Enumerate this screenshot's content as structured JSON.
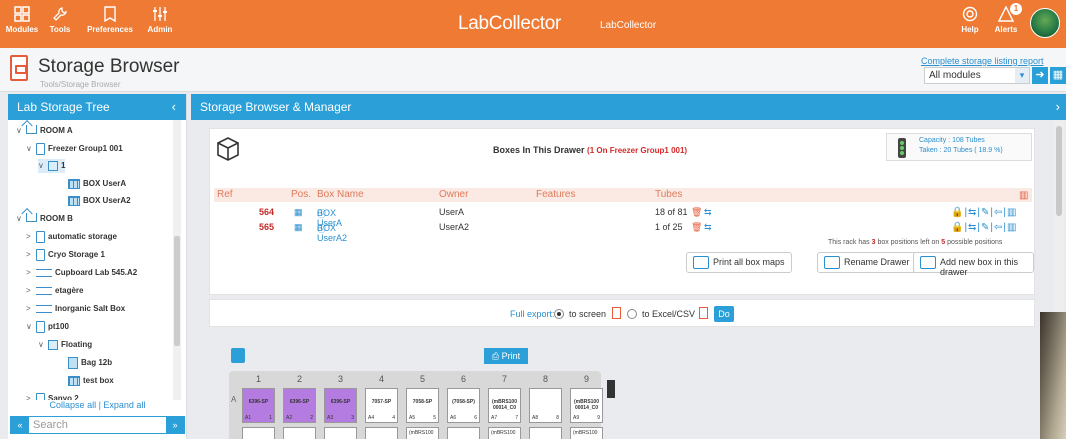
{
  "topbar": {
    "items": [
      {
        "label": "Modules",
        "icon": "grid-icon"
      },
      {
        "label": "Tools",
        "icon": "wrench-icon"
      },
      {
        "label": "Preferences",
        "icon": "bookmark-icon"
      },
      {
        "label": "Admin",
        "icon": "sliders-icon"
      }
    ],
    "logo_text": "LabCollector",
    "logo_sub": "LabCollector",
    "help_label": "Help",
    "alerts_label": "Alerts",
    "alerts_count": "1",
    "brand_color": "#ee7a33",
    "accent_color": "#2a9fd8"
  },
  "page": {
    "title": "Storage Browser",
    "breadcrumb": "Tools/Storage Browser",
    "report_link": "Complete storage listing report",
    "module_select": "All modules"
  },
  "left": {
    "header": "Lab Storage Tree",
    "tree": [
      {
        "label": "ROOM A",
        "icon": "room-icon",
        "toggle": "∨"
      },
      {
        "label": "Freezer Group1 001",
        "icon": "freezer-icon",
        "toggle": "∨"
      },
      {
        "label": "1",
        "icon": "cube-icon",
        "toggle": "∨"
      },
      {
        "label": "BOX UserA",
        "icon": "box-icon",
        "toggle": ""
      },
      {
        "label": "BOX UserA2",
        "icon": "box-icon",
        "toggle": ""
      },
      {
        "label": "ROOM B",
        "icon": "room-icon",
        "toggle": "∨"
      },
      {
        "label": "automatic storage",
        "icon": "freezer-icon",
        "toggle": ">"
      },
      {
        "label": "Cryo Storage 1",
        "icon": "cryo-icon",
        "toggle": ">"
      },
      {
        "label": "Cupboard Lab 545.A2",
        "icon": "shelf-icon",
        "toggle": ">"
      },
      {
        "label": "etagère",
        "icon": "shelf-icon",
        "toggle": ">"
      },
      {
        "label": "Inorganic Salt Box",
        "icon": "shelf-icon",
        "toggle": ">"
      },
      {
        "label": "pt100",
        "icon": "freezer-icon",
        "toggle": "∨"
      },
      {
        "label": "Floating",
        "icon": "cube-icon",
        "toggle": "∨"
      },
      {
        "label": "Bag 12b",
        "icon": "bag-icon",
        "toggle": ""
      },
      {
        "label": "test box",
        "icon": "box-icon",
        "toggle": ""
      },
      {
        "label": "Sanyo 2",
        "icon": "freezer-icon",
        "toggle": ">"
      }
    ],
    "collapse_label": "Collapse all | Expand all",
    "search_placeholder": "Search"
  },
  "main": {
    "header": "Storage Browser & Manager",
    "drawer_title": "Boxes In This Drawer",
    "drawer_location": "(1 On Freezer Group1 001)",
    "capacity": "Capacity : 108 Tubes",
    "taken": "Taken : 20 Tubes ( 18.9 %)",
    "columns": [
      "Ref",
      "Pos.",
      "Box Name",
      "Owner",
      "Features",
      "Tubes"
    ],
    "rows": [
      {
        "ref": "564",
        "box": "BOX UserA",
        "owner": "UserA",
        "tubes": "18 of 81"
      },
      {
        "ref": "565",
        "box": "BOX UserA2",
        "owner": "UserA2",
        "tubes": "1 of 25"
      }
    ],
    "note_prefix": "This rack has",
    "note_n1": "3",
    "note_mid": "box positions left on",
    "note_n2": "5",
    "note_suffix": "possible positions",
    "btn_print": "Print all box maps",
    "btn_rename": "Rename Drawer",
    "btn_add": "Add new box in this drawer",
    "export_label": "Full export:",
    "export_screen": "to screen",
    "export_excel": "to Excel/CSV",
    "do_label": "Do",
    "print_label": "Print"
  },
  "boxmap": {
    "columns": [
      "1",
      "2",
      "3",
      "4",
      "5",
      "6",
      "7",
      "8",
      "9"
    ],
    "row_label": "A",
    "cells": [
      {
        "name": "6396-SP",
        "pos": "A1",
        "n": "1",
        "filled": true
      },
      {
        "name": "6396-SP",
        "pos": "A2",
        "n": "2",
        "filled": true
      },
      {
        "name": "6396-SP",
        "pos": "A3",
        "n": "3",
        "filled": true
      },
      {
        "name": "7057-SP",
        "pos": "A4",
        "n": "4",
        "filled": false
      },
      {
        "name": "7058-SP",
        "pos": "A5",
        "n": "5",
        "filled": false
      },
      {
        "name": "(7058-SP)",
        "pos": "A6",
        "n": "6",
        "filled": false
      },
      {
        "name": "(mBRS100 00014_C0",
        "pos": "A7",
        "n": "7",
        "filled": false
      },
      {
        "name": "",
        "pos": "A8",
        "n": "8",
        "filled": false
      },
      {
        "name": "(mBRS100 00014_C0",
        "pos": "A9",
        "n": "9",
        "filled": false
      }
    ],
    "row2": [
      "",
      "",
      "",
      "",
      "(mBRS100",
      "",
      "(mBRS100",
      "",
      "(mBRS100"
    ]
  }
}
